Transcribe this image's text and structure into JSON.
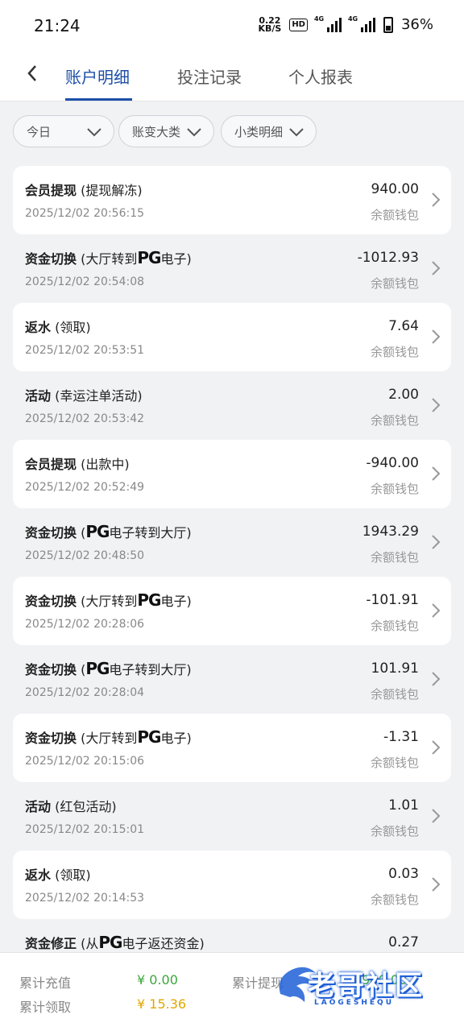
{
  "status": {
    "time": "21:24",
    "speed_value": "0.22",
    "speed_unit": "KB/S",
    "hd": "HD",
    "net1": "4G",
    "net2": "4G",
    "battery": "36%"
  },
  "nav": {
    "tabs": [
      {
        "label": "账户明细",
        "active": true
      },
      {
        "label": "投注记录",
        "active": false
      },
      {
        "label": "个人报表",
        "active": false
      }
    ]
  },
  "filters": [
    {
      "label": "今日"
    },
    {
      "label": "账变大类"
    },
    {
      "label": "小类明细"
    }
  ],
  "records": [
    {
      "category": "会员提现",
      "pre": " (提现解冻)",
      "pg": "",
      "post": "",
      "time": "2025/12/02 20:56:15",
      "amount": "940.00",
      "wallet": "余额钱包"
    },
    {
      "category": "资金切换",
      "pre": " (大厅转到",
      "pg": "PG",
      "post": "电子)",
      "time": "2025/12/02 20:54:08",
      "amount": "-1012.93",
      "wallet": "余额钱包"
    },
    {
      "category": "返水",
      "pre": " (领取)",
      "pg": "",
      "post": "",
      "time": "2025/12/02 20:53:51",
      "amount": "7.64",
      "wallet": "余额钱包"
    },
    {
      "category": "活动",
      "pre": " (幸运注单活动)",
      "pg": "",
      "post": "",
      "time": "2025/12/02 20:53:42",
      "amount": "2.00",
      "wallet": "余额钱包"
    },
    {
      "category": "会员提现",
      "pre": " (出款中)",
      "pg": "",
      "post": "",
      "time": "2025/12/02 20:52:49",
      "amount": "-940.00",
      "wallet": "余额钱包"
    },
    {
      "category": "资金切换",
      "pre": " (",
      "pg": "PG",
      "post": "电子转到大厅)",
      "time": "2025/12/02 20:48:50",
      "amount": "1943.29",
      "wallet": "余额钱包"
    },
    {
      "category": "资金切换",
      "pre": " (大厅转到",
      "pg": "PG",
      "post": "电子)",
      "time": "2025/12/02 20:28:06",
      "amount": "-101.91",
      "wallet": "余额钱包"
    },
    {
      "category": "资金切换",
      "pre": " (",
      "pg": "PG",
      "post": "电子转到大厅)",
      "time": "2025/12/02 20:28:04",
      "amount": "101.91",
      "wallet": "余额钱包"
    },
    {
      "category": "资金切换",
      "pre": " (大厅转到",
      "pg": "PG",
      "post": "电子)",
      "time": "2025/12/02 20:15:06",
      "amount": "-1.31",
      "wallet": "余额钱包"
    },
    {
      "category": "活动",
      "pre": " (红包活动)",
      "pg": "",
      "post": "",
      "time": "2025/12/02 20:15:01",
      "amount": "1.01",
      "wallet": "余额钱包"
    },
    {
      "category": "返水",
      "pre": " (领取)",
      "pg": "",
      "post": "",
      "time": "2025/12/02 20:14:53",
      "amount": "0.03",
      "wallet": "余额钱包"
    },
    {
      "category": "资金修正",
      "pre": " (从",
      "pg": "PG",
      "post": "电子返还资金)",
      "time": "",
      "amount": "0.27",
      "wallet": ""
    }
  ],
  "footer": {
    "recharge_label": "累计充值",
    "recharge_value": "¥ 0.00",
    "withdraw_label": "累计提现",
    "withdraw_value": "¥ 940.00",
    "claim_label": "累计领取",
    "claim_value": "¥ 15.36",
    "colors": {
      "recharge": "#3aa83a",
      "claim": "#e0a800"
    }
  },
  "watermark": {
    "text": "老哥社区",
    "sub": "LAOGESHEQU"
  }
}
